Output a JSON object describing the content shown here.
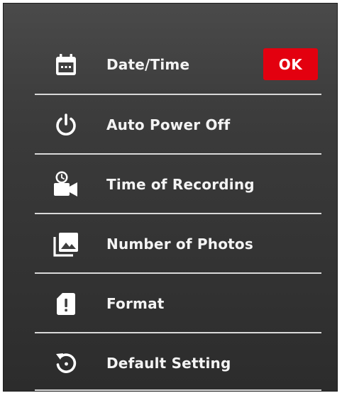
{
  "menu": {
    "items": [
      {
        "label": "Date/Time",
        "icon": "calendar-icon"
      },
      {
        "label": "Auto Power Off",
        "icon": "power-icon"
      },
      {
        "label": "Time of Recording",
        "icon": "video-timer-icon"
      },
      {
        "label": "Number of Photos",
        "icon": "photo-stack-icon"
      },
      {
        "label": "Format",
        "icon": "sd-card-alert-icon"
      },
      {
        "label": "Default Setting",
        "icon": "reset-icon"
      }
    ]
  },
  "ok_badge": {
    "label": "OK",
    "color": "#e3000f"
  },
  "colors": {
    "background": "#3a3a3a",
    "text": "#f4f4f4",
    "divider": "#d9d9d9",
    "accent": "#e3000f"
  }
}
